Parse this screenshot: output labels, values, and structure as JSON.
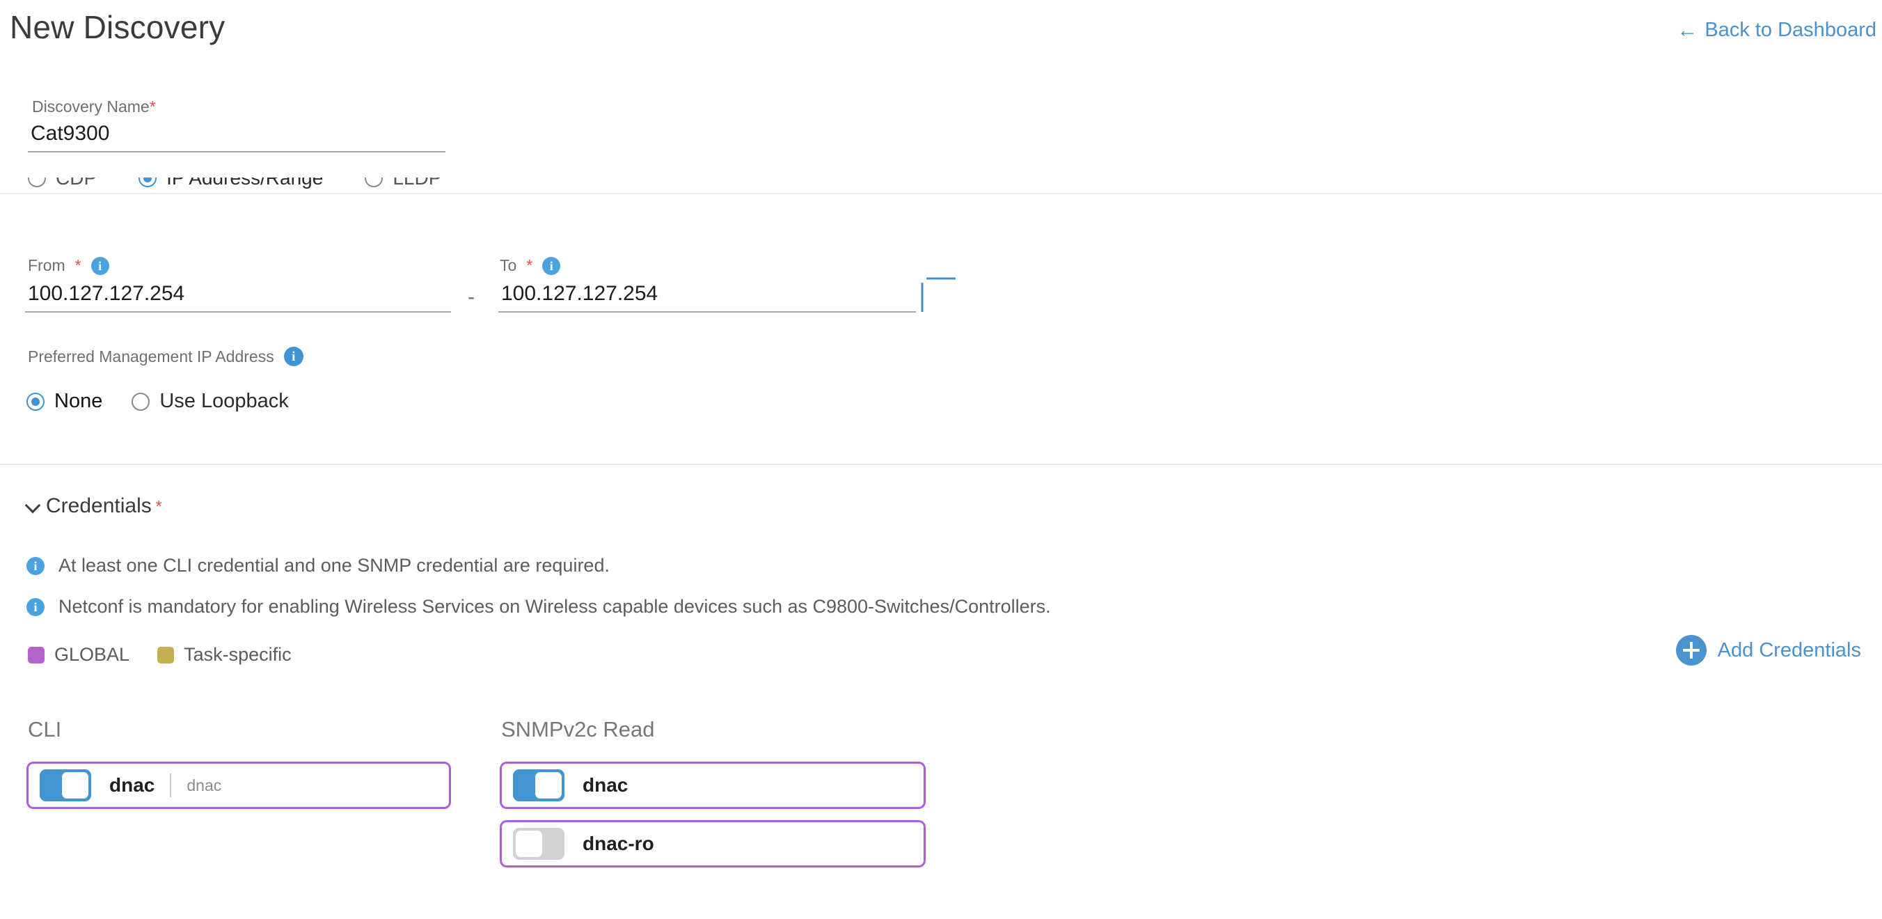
{
  "header": {
    "title": "New Discovery",
    "back_link": "Back to Dashboard",
    "back_arrow_glyph": "←"
  },
  "discovery_name": {
    "label": "Discovery Name",
    "required_mark": "*",
    "value": "Cat9300",
    "placeholder": "Discovery Name"
  },
  "discovery_type": {
    "options": [
      {
        "label": "CDP",
        "selected": false
      },
      {
        "label": "IP Address/Range",
        "selected": true
      },
      {
        "label": "LLDP",
        "selected": false
      }
    ]
  },
  "ip_range": {
    "from_label": "From",
    "to_label": "To",
    "required_mark": "*",
    "from_value": "100.127.127.254",
    "to_value": "100.127.127.254",
    "dash": "-",
    "info_glyph": "i",
    "add_button_label": "+"
  },
  "preferred_mgmt_ip": {
    "label": "Preferred Management IP Address",
    "info_glyph": "i",
    "options": [
      {
        "label": "None",
        "selected": true
      },
      {
        "label": "Use Loopback",
        "selected": false
      }
    ]
  },
  "credentials": {
    "section_title": "Credentials",
    "required_mark": "*",
    "notes": [
      "At least one CLI credential and one SNMP credential are required.",
      "Netconf is mandatory for enabling Wireless Services on Wireless capable devices such as C9800-Switches/Controllers."
    ],
    "legend": [
      {
        "label": "GLOBAL",
        "color": "#b563cc"
      },
      {
        "label": "Task-specific",
        "color": "#c4b052"
      }
    ],
    "add_button_label": "Add Credentials",
    "columns": [
      {
        "title": "CLI",
        "items": [
          {
            "name": "dnac",
            "sub": "dnac",
            "enabled": true,
            "scope_color": "#b05ed8"
          }
        ]
      },
      {
        "title": "SNMPv2c Read",
        "items": [
          {
            "name": "dnac",
            "sub": "",
            "enabled": true,
            "scope_color": "#b05ed8"
          },
          {
            "name": "dnac-ro",
            "sub": "",
            "enabled": false,
            "scope_color": "#b05ed8"
          }
        ]
      }
    ]
  },
  "colors": {
    "accent_blue": "#4b91cc",
    "toggle_on": "#4395d2",
    "toggle_off": "#d2d2d2",
    "card_border_purple": "#b05ed8",
    "required_red": "#d9534f",
    "info_blue": "#3f94d6",
    "divider": "#e7e7e7"
  }
}
